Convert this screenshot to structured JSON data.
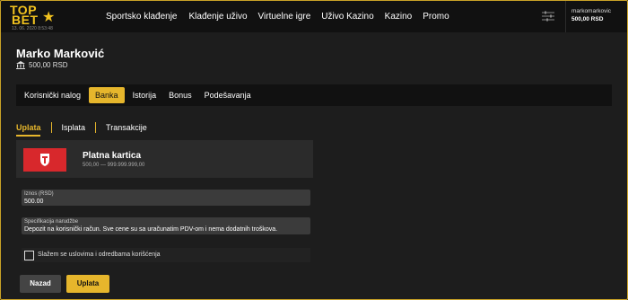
{
  "header": {
    "logo_top": "TOP",
    "logo_bottom": "BET",
    "logo_date": "13. 06. 2020 8:53:48",
    "nav": [
      "Sportsko klađenje",
      "Klađenje uživo",
      "Virtuelne igre",
      "Uživo Kazino",
      "Kazino",
      "Promo"
    ],
    "username": "markomarkovic",
    "balance": "500,00 RSD"
  },
  "account": {
    "name": "Marko Marković",
    "balance": "500,00 RSD"
  },
  "tabs": [
    {
      "label": "Korisnički nalog",
      "active": false
    },
    {
      "label": "Banka",
      "active": true
    },
    {
      "label": "Istorija",
      "active": false
    },
    {
      "label": "Bonus",
      "active": false
    },
    {
      "label": "Podešavanja",
      "active": false
    }
  ],
  "subtabs": [
    "Uplata",
    "Isplata",
    "Transakcije"
  ],
  "method": {
    "title": "Platna kartica",
    "range": "500,00 — 999.999.999,00"
  },
  "form": {
    "amount_label": "Iznos (RSD)",
    "amount_value": "500.00",
    "spec_label": "Specifikacija narudžbe",
    "spec_value": "Depozit na korisnički račun. Sve cene su sa uračunatim PDV-om i nema dodatnih troškova.",
    "terms_label": "Slažem se uslovima i odredbama korišćenja",
    "terms_checked": false
  },
  "buttons": {
    "back": "Nazad",
    "submit": "Uplata"
  },
  "colors": {
    "accent": "#e6b62c",
    "bg": "#1d1d1d",
    "card_logo": "#d8282c"
  }
}
